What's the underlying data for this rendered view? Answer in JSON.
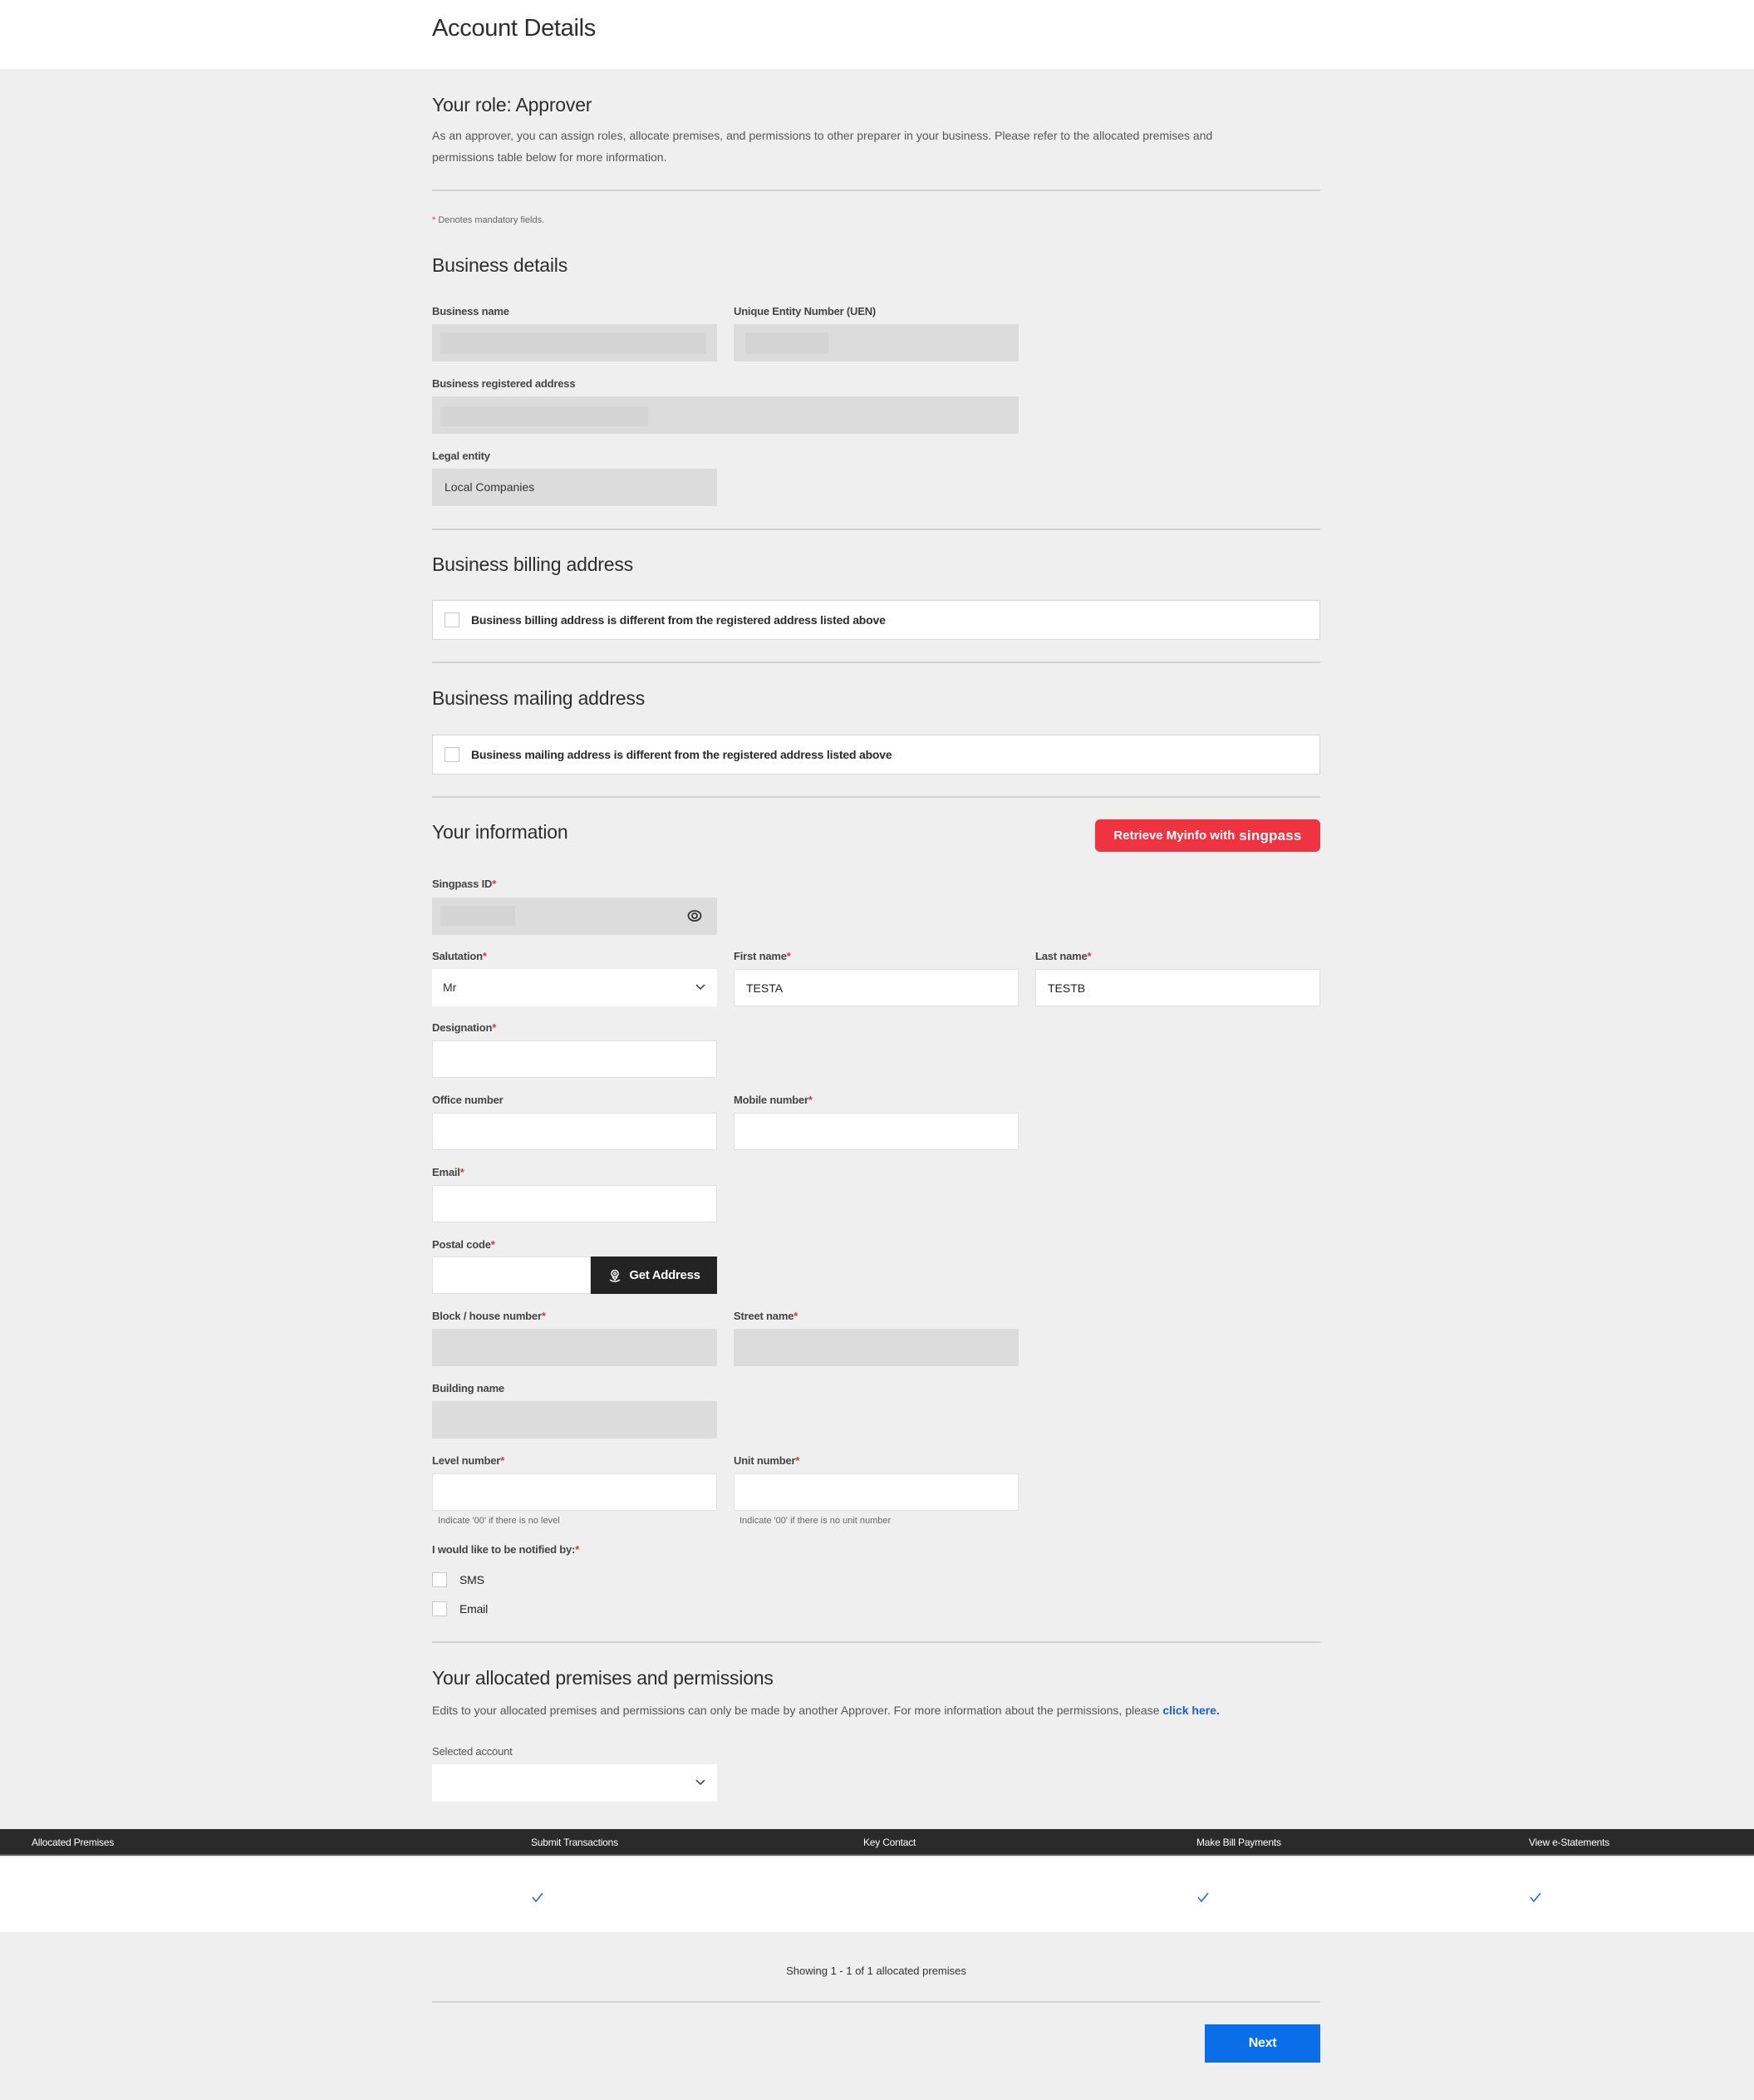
{
  "page": {
    "title": "Account Details"
  },
  "role": {
    "heading": "Your role: Approver",
    "description_line1": "As an approver, you can assign roles, allocate premises, and permissions to other preparer in your business. Please refer to the allocated premises and",
    "description_line2": "permissions table below for more information."
  },
  "mandatory_note": {
    "asterisk": "*",
    "text": " Denotes mandatory fields."
  },
  "business_details": {
    "heading": "Business details",
    "business_name_label": "Business name",
    "uen_label": "Unique Entity Number (UEN)",
    "registered_address_label": "Business registered address",
    "legal_entity_label": "Legal entity",
    "legal_entity_value": "Local Companies"
  },
  "billing": {
    "heading": "Business billing address",
    "checkbox_label": "Business billing address is different from the registered address listed above",
    "checked": false
  },
  "mailing": {
    "heading": "Business mailing address",
    "checkbox_label": "Business mailing address is different from the registered address listed above",
    "checked": false
  },
  "your_info": {
    "heading": "Your information",
    "retrieve_button": {
      "prefix": "Retrieve Myinfo with",
      "brand": "singpass",
      "color": "#ef3340"
    },
    "required_mark": "*",
    "singpass_id_label": "Singpass ID",
    "salutation_label": "Salutation",
    "salutation_value": "Mr",
    "first_name_label": "First name",
    "first_name_value": "TESTA",
    "last_name_label": "Last name",
    "last_name_value": "TESTB",
    "designation_label": "Designation",
    "designation_value": "",
    "office_number_label": "Office number",
    "office_number_value": "",
    "mobile_number_label": "Mobile number",
    "mobile_number_value": "",
    "email_label": "Email",
    "email_value": "",
    "postal_code_label": "Postal code",
    "postal_code_value": "",
    "get_address_button": "Get Address",
    "block_label": "Block / house number",
    "street_label": "Street name",
    "building_label": "Building name",
    "level_label": "Level number",
    "level_value": "",
    "level_hint": "Indicate '00' if there is no level",
    "unit_label": "Unit number",
    "unit_value": "",
    "unit_hint": "Indicate '00' if there is no unit number",
    "notify_label": "I would like to be notified by:",
    "notify_options": [
      {
        "label": "SMS",
        "checked": false
      },
      {
        "label": "Email",
        "checked": false
      }
    ]
  },
  "premises": {
    "heading": "Your allocated premises and permissions",
    "description": "Edits to your allocated premises and permissions can only be made by another Approver. For more information about the permissions, please ",
    "link_text": "click here.",
    "selected_account_label": "Selected account",
    "selected_account_value": "",
    "table": {
      "columns": [
        "Allocated Premises",
        "Submit Transactions",
        "Key Contact",
        "Make Bill Payments",
        "View e-Statements"
      ],
      "rows": [
        {
          "allocated_premises": "",
          "submit_transactions": true,
          "key_contact": false,
          "make_bill_payments": true,
          "view_e_statements": true
        }
      ]
    },
    "showing_text": "Showing 1 - 1 of 1 allocated premises"
  },
  "footer": {
    "next_button": "Next",
    "next_color": "#0a6ee8"
  }
}
